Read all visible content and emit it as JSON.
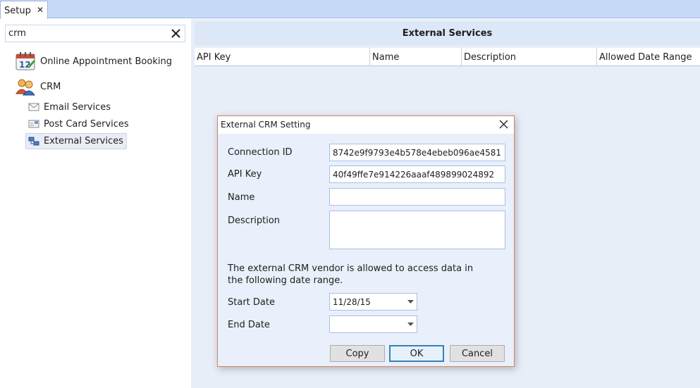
{
  "tabs": [
    {
      "label": "Setup",
      "close": "✕"
    }
  ],
  "search": {
    "value": "crm"
  },
  "tree": {
    "online_booking": "Online Appointment Booking",
    "crm": "CRM",
    "children": [
      {
        "label": "Email Services",
        "icon": "envelope-icon"
      },
      {
        "label": "Post Card Services",
        "icon": "postcard-icon"
      },
      {
        "label": "External Services",
        "icon": "network-icon",
        "selected": true
      }
    ]
  },
  "main": {
    "header": "External Services",
    "columns": [
      "API Key",
      "Name",
      "Description",
      "Allowed Date Range"
    ]
  },
  "dialog": {
    "title": "External CRM Setting",
    "fields": {
      "connection_id": {
        "label": "Connection ID",
        "value": "8742e9f9793e4b578e4ebeb096ae4581"
      },
      "api_key": {
        "label": "API Key",
        "value": "40f49ffe7e914226aaaf489899024892"
      },
      "name": {
        "label": "Name",
        "value": ""
      },
      "description": {
        "label": "Description",
        "value": ""
      }
    },
    "note": "The external CRM vendor is allowed to access data in the following date range.",
    "start_date": {
      "label": "Start Date",
      "value": "11/28/15"
    },
    "end_date": {
      "label": "End Date",
      "value": ""
    },
    "buttons": {
      "copy": "Copy",
      "ok": "OK",
      "cancel": "Cancel"
    }
  },
  "colors": {
    "tabstrip": "#c6d9f7",
    "panel_bg": "#e8eef8",
    "dialog_border": "#d9835f",
    "default_button_border": "#3c7fb1"
  }
}
